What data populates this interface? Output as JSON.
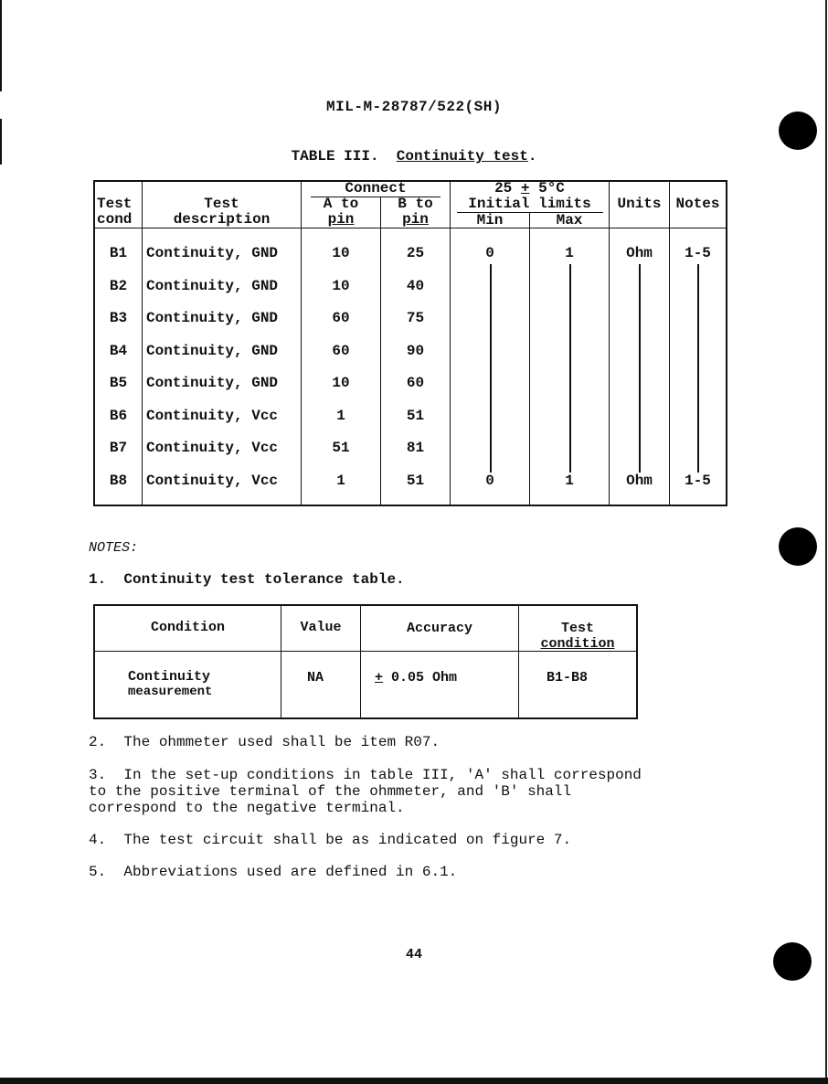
{
  "document": {
    "id": "MIL-M-28787/522(SH)",
    "page_number": "44"
  },
  "table3": {
    "title_prefix": "TABLE III.",
    "title_main": "Continuity test",
    "title_suffix": ".",
    "headers": {
      "test_cond_1": "Test",
      "test_cond_2": "cond",
      "desc_1": "Test",
      "desc_2": "description",
      "connect": "Connect",
      "a_to_1": "A to",
      "a_to_2": "pin",
      "b_to_1": "B to",
      "b_to_2": "pin",
      "temp_pre": "25 ",
      "temp_pm": "+",
      "temp_post": " 5°C",
      "initial_limits": "Initial limits",
      "min": "Min",
      "max": "Max",
      "units": "Units",
      "notes": "Notes"
    },
    "rows": [
      {
        "cond": "B1",
        "desc": "Continuity, GND",
        "a": "10",
        "b": "25"
      },
      {
        "cond": "B2",
        "desc": "Continuity, GND",
        "a": "10",
        "b": "40"
      },
      {
        "cond": "B3",
        "desc": "Continuity, GND",
        "a": "60",
        "b": "75"
      },
      {
        "cond": "B4",
        "desc": "Continuity, GND",
        "a": "60",
        "b": "90"
      },
      {
        "cond": "B5",
        "desc": "Continuity, GND",
        "a": "10",
        "b": "60"
      },
      {
        "cond": "B6",
        "desc": "Continuity, Vcc",
        "a": "1",
        "b": "51"
      },
      {
        "cond": "B7",
        "desc": "Continuity, Vcc",
        "a": "51",
        "b": "81"
      },
      {
        "cond": "B8",
        "desc": "Continuity, Vcc",
        "a": "1",
        "b": "51"
      }
    ],
    "limits": {
      "min": "0",
      "max": "1",
      "units": "Ohm",
      "notes": "1-5"
    }
  },
  "notes": {
    "label": "NOTES:",
    "note1": "1.  Continuity test tolerance table.",
    "tolerance_table": {
      "headers": {
        "condition": "Condition",
        "value": "Value",
        "accuracy": "Accuracy",
        "test_cond_1": "Test",
        "test_cond_2": "condition"
      },
      "row": {
        "condition_1": "Continuity",
        "condition_2": "measurement",
        "value": "NA",
        "accuracy_pm": "+",
        "accuracy": " 0.05 Ohm",
        "test_condition": "B1-B8"
      }
    },
    "note2": "2.  The ohmmeter used shall be item R07.",
    "note3": "3.  In the set-up conditions in table III, 'A' shall correspond\nto the positive terminal of the ohmmeter, and 'B' shall\ncorrespond to the negative terminal.",
    "note4": "4.  The test circuit shall be as indicated on figure 7.",
    "note5": "5.  Abbreviations used are defined in 6.1."
  }
}
